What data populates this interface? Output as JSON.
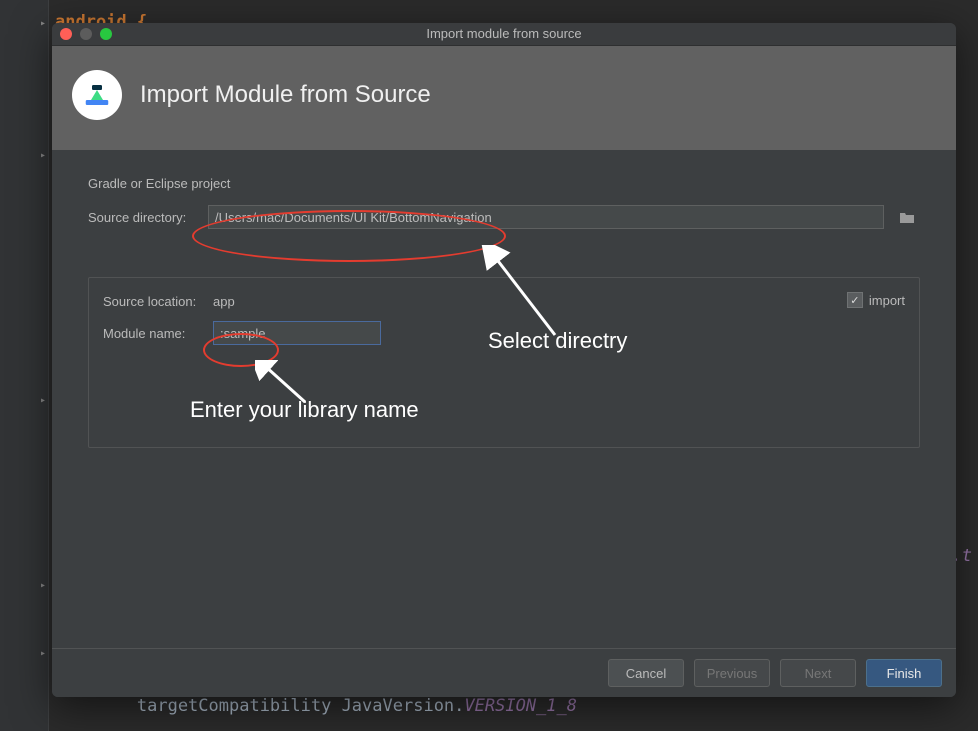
{
  "titlebar": {
    "title": "Import module from source"
  },
  "header": {
    "title": "Import Module from Source"
  },
  "body": {
    "project_hint": "Gradle or Eclipse project",
    "source_dir_label": "Source directory:",
    "source_dir_value": "/Users/mac/Documents/UI Kit/BottomNavigation",
    "panel": {
      "source_location_label": "Source location:",
      "source_location_value": "app",
      "module_name_label": "Module name:",
      "module_name_value": ":sample",
      "import_label": "import"
    }
  },
  "footer": {
    "cancel": "Cancel",
    "previous": "Previous",
    "next": "Next",
    "finish": "Finish"
  },
  "annotations": {
    "select_dir": "Select directry",
    "enter_name": "Enter your library name"
  },
  "bg_code": {
    "line_top": "android {",
    "line_target": "        targetCompatibility JavaVersion.",
    "line_target_enum": "VERSION_1_8",
    "tail_hint": ".t"
  }
}
